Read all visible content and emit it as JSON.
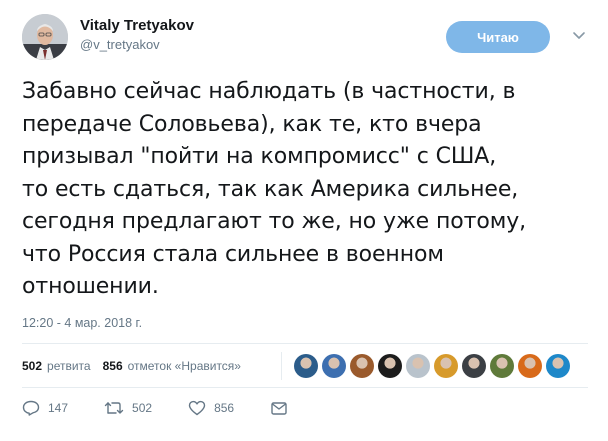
{
  "author": {
    "display_name": "Vitaly Tretyakov",
    "username": "@v_tretyakov",
    "avatar_icon": "profile-photo"
  },
  "follow_button": {
    "label": "Читаю",
    "color": "#7fb7e8"
  },
  "tweet": {
    "text": "Забавно сейчас наблюдать (в частности, в\nпередаче Соловьева), как те, кто вчера\nпризывал \"пойти на компромисс\" с США,\nто есть сдаться, так как Америка сильнее,\nсегодня предлагают то же, но уже потому,\nчто Россия стала сильнее в военном\nотношении.",
    "timestamp": "12:20 - 4 мар. 2018 г."
  },
  "stats": {
    "retweets_count": "502",
    "retweets_label": "ретвита",
    "likes_count": "856",
    "likes_label": "отметок «Нравится»"
  },
  "likers": [
    {
      "color": "#2b5c8a"
    },
    {
      "color": "#3d6fb0"
    },
    {
      "color": "#9a5a2c"
    },
    {
      "color": "#1c1c1c"
    },
    {
      "color": "#b9c3cc"
    },
    {
      "color": "#d79a2b"
    },
    {
      "color": "#3b3f44"
    },
    {
      "color": "#5f7a3a"
    },
    {
      "color": "#d86a1a"
    },
    {
      "color": "#1e88c9"
    }
  ],
  "actions": {
    "replies": "147",
    "retweets": "502",
    "likes": "856"
  },
  "colors": {
    "text": "#14171a",
    "secondary": "#657786",
    "divider": "#e6ecf0"
  }
}
